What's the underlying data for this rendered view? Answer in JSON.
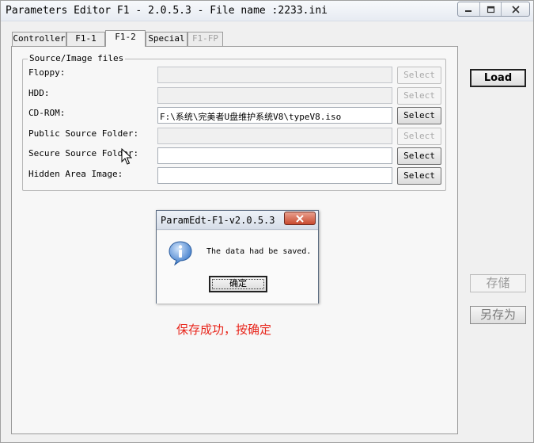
{
  "window": {
    "title": "Parameters Editor F1 - 2.0.5.3 - File name :2233.ini",
    "controls": {
      "minimize": "minimize-icon",
      "maximize": "maximize-icon",
      "close": "close-icon"
    }
  },
  "tabs": [
    {
      "label": "Controller",
      "active": false,
      "disabled": false
    },
    {
      "label": "F1-1",
      "active": false,
      "disabled": false
    },
    {
      "label": "F1-2",
      "active": true,
      "disabled": false
    },
    {
      "label": "Special",
      "active": false,
      "disabled": false
    },
    {
      "label": "F1-FP",
      "active": false,
      "disabled": true
    }
  ],
  "source_group": {
    "legend": "Source/Image files",
    "fields": [
      {
        "label": "Floppy:",
        "value": "",
        "enabled": false,
        "button": "Select",
        "button_enabled": false
      },
      {
        "label": "HDD:",
        "value": "",
        "enabled": false,
        "button": "Select",
        "button_enabled": false
      },
      {
        "label": "CD-ROM:",
        "value": "F:\\系统\\完美者U盘维护系统V8\\typeV8.iso",
        "enabled": true,
        "button": "Select",
        "button_enabled": true
      },
      {
        "label": "Public Source Folder:",
        "value": "",
        "enabled": false,
        "button": "Select",
        "button_enabled": false
      },
      {
        "label": "Secure Source Folder:",
        "value": "",
        "enabled": true,
        "button": "Select",
        "button_enabled": true
      },
      {
        "label": "Hidden Area Image:",
        "value": "",
        "enabled": true,
        "button": "Select",
        "button_enabled": true
      }
    ]
  },
  "side_buttons": {
    "load": "Load",
    "save": "存储",
    "save_as": "另存为"
  },
  "dialog": {
    "title": "ParamEdt-F1-v2.0.5.3",
    "message": "The data had be saved.",
    "ok": "确定",
    "icon": "info-icon"
  },
  "annotation": {
    "text": "保存成功，按确定",
    "color": "#e8261c"
  },
  "colors": {
    "accent_red": "#e8261c",
    "window_bg": "#f0f0f0"
  }
}
